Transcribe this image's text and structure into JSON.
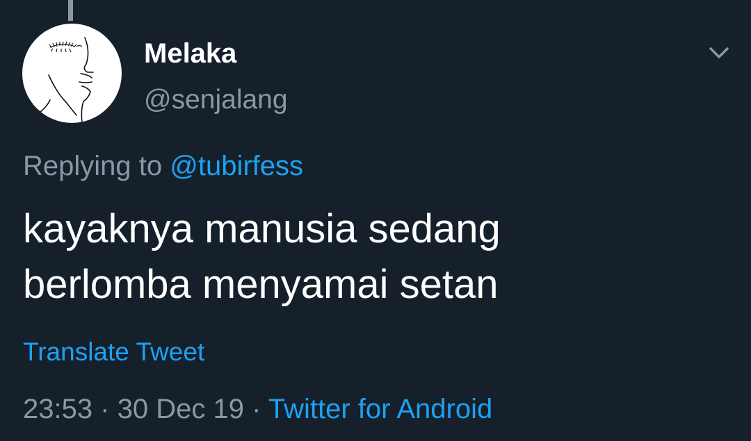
{
  "tweet": {
    "author": {
      "display_name": "Melaka",
      "handle": "@senjalang",
      "avatar_icon": "line-art-face-avatar"
    },
    "reply": {
      "prefix": "Replying to",
      "mention": "@tubirfess"
    },
    "text_lines": [
      "kayaknya manusia sedang",
      "berlomba menyamai setan"
    ],
    "translate_label": "Translate Tweet",
    "time": "23:53",
    "separator": "·",
    "date": "30 Dec 19",
    "source": "Twitter for Android",
    "menu_icon": "chevron-down-icon"
  },
  "colors": {
    "background": "#15202b",
    "primary_text": "#ffffff",
    "secondary_text": "#8899a6",
    "accent": "#1da1f2"
  }
}
